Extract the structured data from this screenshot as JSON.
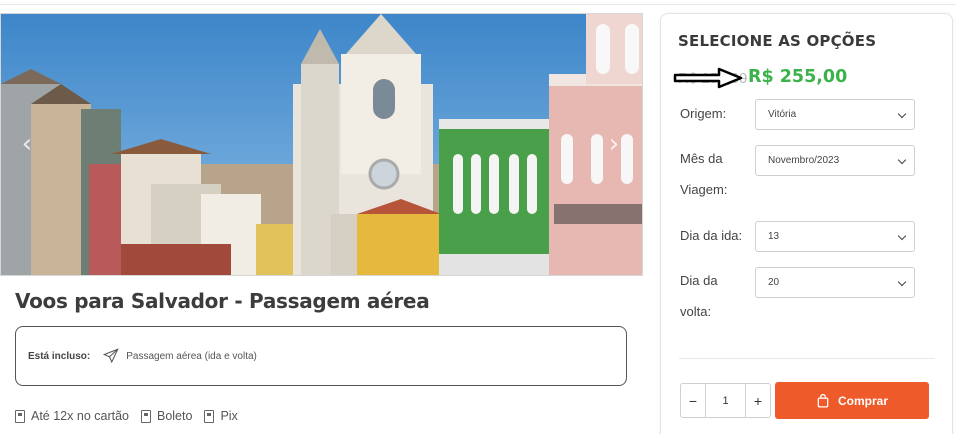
{
  "product": {
    "title": "Voos para Salvador - Passagem aérea",
    "included_label": "Está incluso:",
    "included_item": "Passagem aérea (ida e volta)"
  },
  "payments": [
    {
      "label": "Até 12x no cartão",
      "icon": "card-icon"
    },
    {
      "label": "Boleto",
      "icon": "barcode-icon"
    },
    {
      "label": "Pix",
      "icon": "pix-icon"
    }
  ],
  "panel": {
    "title": "SELECIONE AS OPÇÕES",
    "price_old": "R$ 255,00",
    "price_new": "R$ 255,00",
    "options": [
      {
        "label": "Origem:",
        "value": "Vitória"
      },
      {
        "label_line1": "Mês da",
        "label_line2": "Viagem:",
        "value": "Novembro/2023"
      },
      {
        "label": "Dia da ida:",
        "value": "13"
      },
      {
        "label_line1": "Dia da",
        "label_line2": "volta:",
        "value": "20"
      }
    ],
    "quantity": "1",
    "minus": "−",
    "plus": "+",
    "buy_label": "Comprar"
  },
  "colors": {
    "accent_green": "#3bb24a",
    "buy_orange": "#ef5a2a"
  }
}
